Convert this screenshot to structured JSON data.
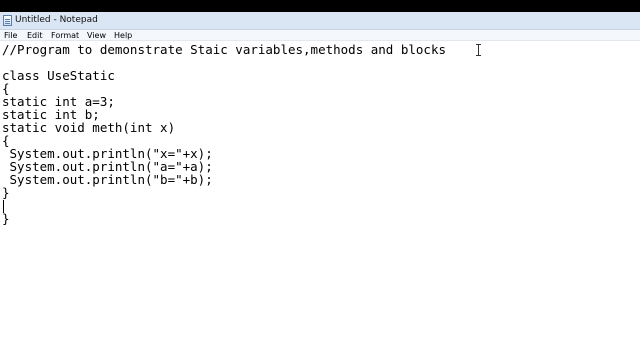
{
  "window": {
    "title": "Untitled - Notepad",
    "app_icon": "notepad-icon"
  },
  "menu": {
    "items": [
      "File",
      "Edit",
      "Format",
      "View",
      "Help"
    ]
  },
  "editor": {
    "lines": [
      "//Program to demonstrate Staic variables,methods and blocks",
      "",
      "class UseStatic",
      "{",
      "static int a=3;",
      "static int b;",
      "static void meth(int x)",
      "{",
      " System.out.println(\"x=\"+x);",
      " System.out.println(\"a=\"+a);",
      " System.out.println(\"b=\"+b);",
      "}",
      "",
      "}"
    ],
    "pointer": "i-beam-cursor-icon"
  }
}
